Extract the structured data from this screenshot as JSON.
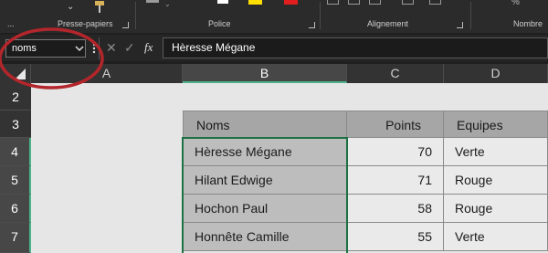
{
  "ribbon": {
    "groups": [
      "Presse-papiers",
      "Police",
      "Alignement",
      "Nombre"
    ],
    "partial_left": "...",
    "number_glyph": "%"
  },
  "formula_bar": {
    "name_box_value": "noms",
    "cancel_glyph": "✕",
    "enter_glyph": "✓",
    "fx_label": "fx",
    "formula_value": "Hèresse Mégane"
  },
  "columns": [
    "A",
    "B",
    "C",
    "D"
  ],
  "rows": [
    "2",
    "3",
    "4",
    "5",
    "6",
    "7"
  ],
  "table": {
    "headers": [
      "Noms",
      "Points",
      "Equipes"
    ],
    "rows": [
      [
        "Hèresse Mégane",
        "70",
        "Verte"
      ],
      [
        "Hilant Edwige",
        "71",
        "Rouge"
      ],
      [
        "Hochon Paul",
        "58",
        "Rouge"
      ],
      [
        "Honnête Camille",
        "55",
        "Verte"
      ]
    ]
  },
  "colors": {
    "selection_green": "#1e7145",
    "annotation_red": "#b3262b",
    "font_color_yellow": "#ffdf00",
    "font_color_red": "#e11d1d"
  }
}
